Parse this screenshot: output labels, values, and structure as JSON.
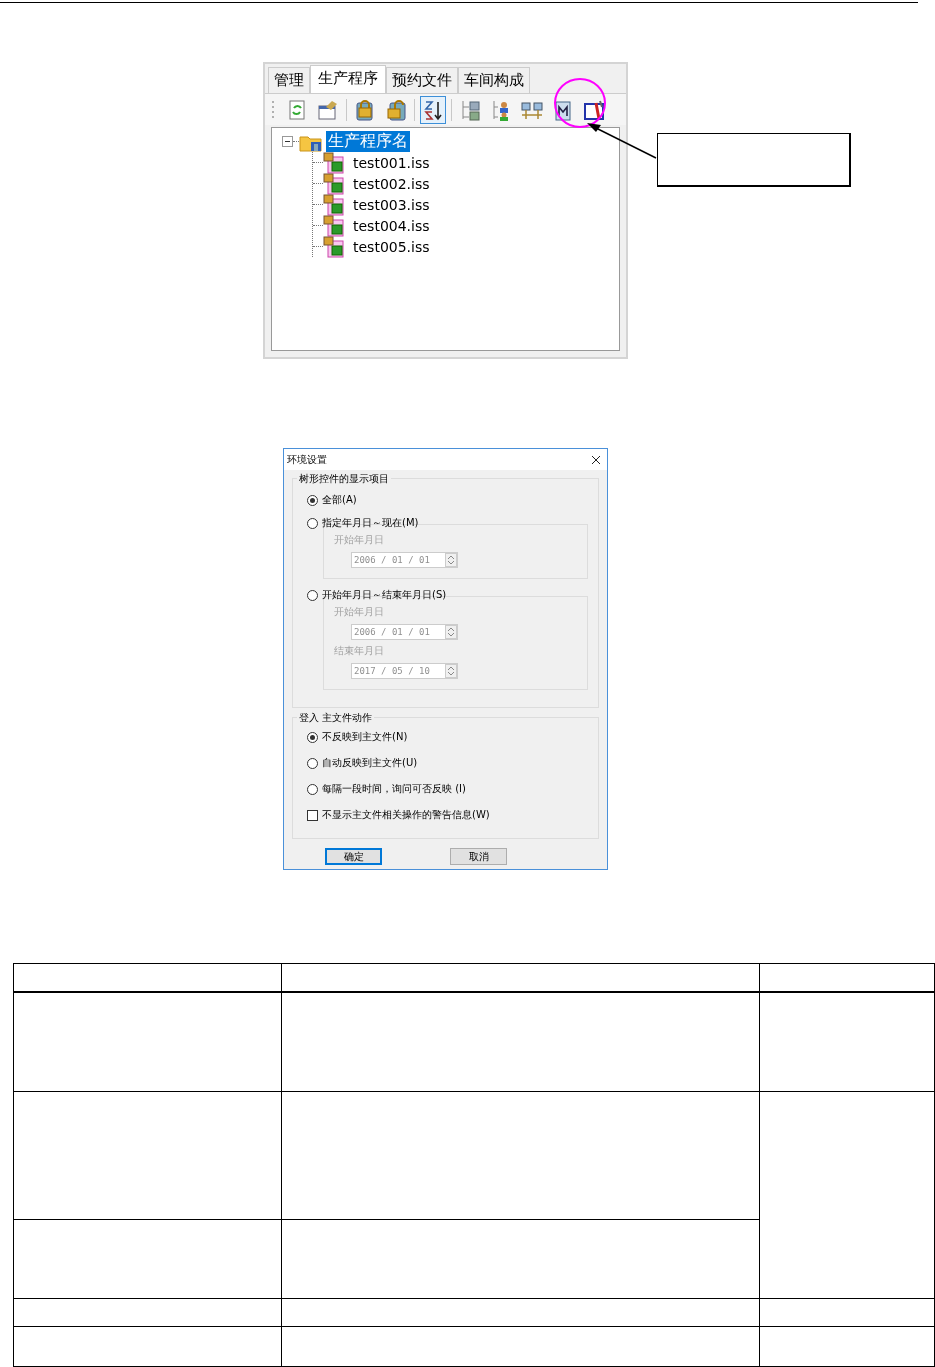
{
  "panel": {
    "tabs": [
      {
        "label": "管理",
        "selected": false
      },
      {
        "label": "生产程序",
        "selected": true
      },
      {
        "label": "预约文件",
        "selected": false
      },
      {
        "label": "车间构成",
        "selected": false
      }
    ],
    "toolbar": [
      {
        "kind": "refresh",
        "on": false
      },
      {
        "kind": "properties",
        "on": false
      },
      {
        "kind": "lock",
        "on": false
      },
      {
        "kind": "unlock",
        "on": false
      },
      {
        "kind": "sort",
        "on": true
      },
      {
        "kind": "tree",
        "on": false
      },
      {
        "kind": "person",
        "on": false
      },
      {
        "kind": "network",
        "on": false
      },
      {
        "kind": "document",
        "on": false
      },
      {
        "kind": "settings",
        "on": false
      }
    ],
    "tree": [
      {
        "label": "生产程序名",
        "selected": true,
        "expanded": true,
        "children": [
          {
            "label": "test001.iss",
            "selected": false
          },
          {
            "label": "test002.iss",
            "selected": false
          },
          {
            "label": "test003.iss",
            "selected": false
          },
          {
            "label": "test004.iss",
            "selected": false
          },
          {
            "label": "test005.iss",
            "selected": false
          }
        ]
      }
    ]
  },
  "annotations": [
    {
      "kind": "circle"
    },
    {
      "kind": "arrow"
    },
    {
      "kind": "box"
    }
  ],
  "dialog": {
    "title": "环境设置",
    "groups": [
      {
        "label": "树形控件的显示项目",
        "items": [
          {
            "kind": "radio",
            "label": "全部(A)",
            "selected": true
          },
          {
            "kind": "radio",
            "label": "指定年月日～现在(M)",
            "selected": false,
            "dates": [
              {
                "label": "开始年月日",
                "value": "2006 / 01 / 01",
                "disabled": true
              }
            ]
          },
          {
            "kind": "radio",
            "label": "开始年月日～结束年月日(S)",
            "selected": false,
            "dates": [
              {
                "label": "开始年月日",
                "value": "2006 / 01 / 01",
                "disabled": true
              },
              {
                "label": "结束年月日",
                "value": "2017 / 05 / 10",
                "disabled": true
              }
            ]
          }
        ]
      },
      {
        "label": "登入 主文件动作",
        "items": [
          {
            "kind": "radio",
            "label": "不反映到主文件(N)",
            "selected": true
          },
          {
            "kind": "radio",
            "label": "自动反映到主文件(U)",
            "selected": false
          },
          {
            "kind": "radio",
            "label": "每隔一段时间，询问可否反映 (I)",
            "selected": false
          },
          {
            "kind": "checkbox",
            "label": "不显示主文件相关操作的警告信息(W)",
            "checked": false
          }
        ]
      }
    ],
    "buttons": [
      {
        "label": "确定",
        "default": true
      },
      {
        "label": "取消",
        "default": false
      }
    ]
  },
  "table": {
    "rows": [
      {
        "kind": "header"
      },
      {
        "kind": "large"
      },
      {
        "kind": "mergetop"
      },
      {
        "kind": "mergebottom"
      },
      {
        "kind": "small"
      },
      {
        "kind": "tall"
      }
    ]
  }
}
